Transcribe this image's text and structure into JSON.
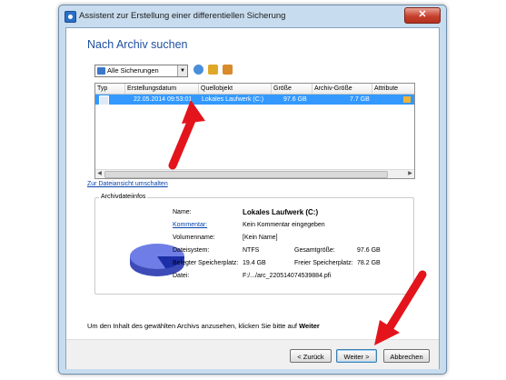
{
  "window": {
    "title": "Assistent zur Erstellung einer differentiellen Sicherung",
    "close_glyph": "✕"
  },
  "page": {
    "heading": "Nach Archiv suchen"
  },
  "toolbar": {
    "filter_value": "Alle Sicherungen",
    "icons": [
      "refresh-icon",
      "add-archive-icon",
      "remove-archive-icon"
    ]
  },
  "table": {
    "columns": [
      "Typ",
      "Erstellungsdatum",
      "Quellobjekt",
      "Größe",
      "Archiv-Größe",
      "Attribute"
    ],
    "rows": [
      {
        "date": "22.05.2014 09:53:01",
        "source": "Lokales Laufwerk (C:)",
        "size": "97.6 GB",
        "archive_size": "7.7 GB"
      }
    ]
  },
  "switch_link": "Zur Dateiansicht umschalten",
  "info": {
    "group_title": "Archivdateiinfos",
    "name_label": "Name:",
    "name_value": "Lokales Laufwerk (C:)",
    "comment_label": "Kommentar:",
    "comment_value": "Kein Kommentar eingegeben",
    "volume_label": "Volumenname:",
    "volume_value": "[Kein Name]",
    "fs_label": "Dateisystem:",
    "fs_value": "NTFS",
    "total_label": "Gesamtgröße:",
    "total_value": "97.6 GB",
    "used_label": "Belegter Speicherplatz:",
    "used_value": "19.4 GB",
    "free_label": "Freier Speicherplatz:",
    "free_value": "78.2 GB",
    "file_label": "Datei:",
    "file_value": "F:/.../arc_220514074539884.pfi",
    "used_fraction": 0.2
  },
  "instruction": {
    "text": "Um den Inhalt des gewählten Archivs anzusehen, klicken Sie bitte auf ",
    "bold": "Weiter"
  },
  "buttons": {
    "back": "< Zurück",
    "next": "Weiter >",
    "cancel": "Abbrechen"
  },
  "colors": {
    "selection": "#3399ff",
    "heading": "#1e4fa0",
    "arrow": "#e3141b",
    "pie_free": "#6f7ee6",
    "pie_used": "#1c2fa8"
  }
}
